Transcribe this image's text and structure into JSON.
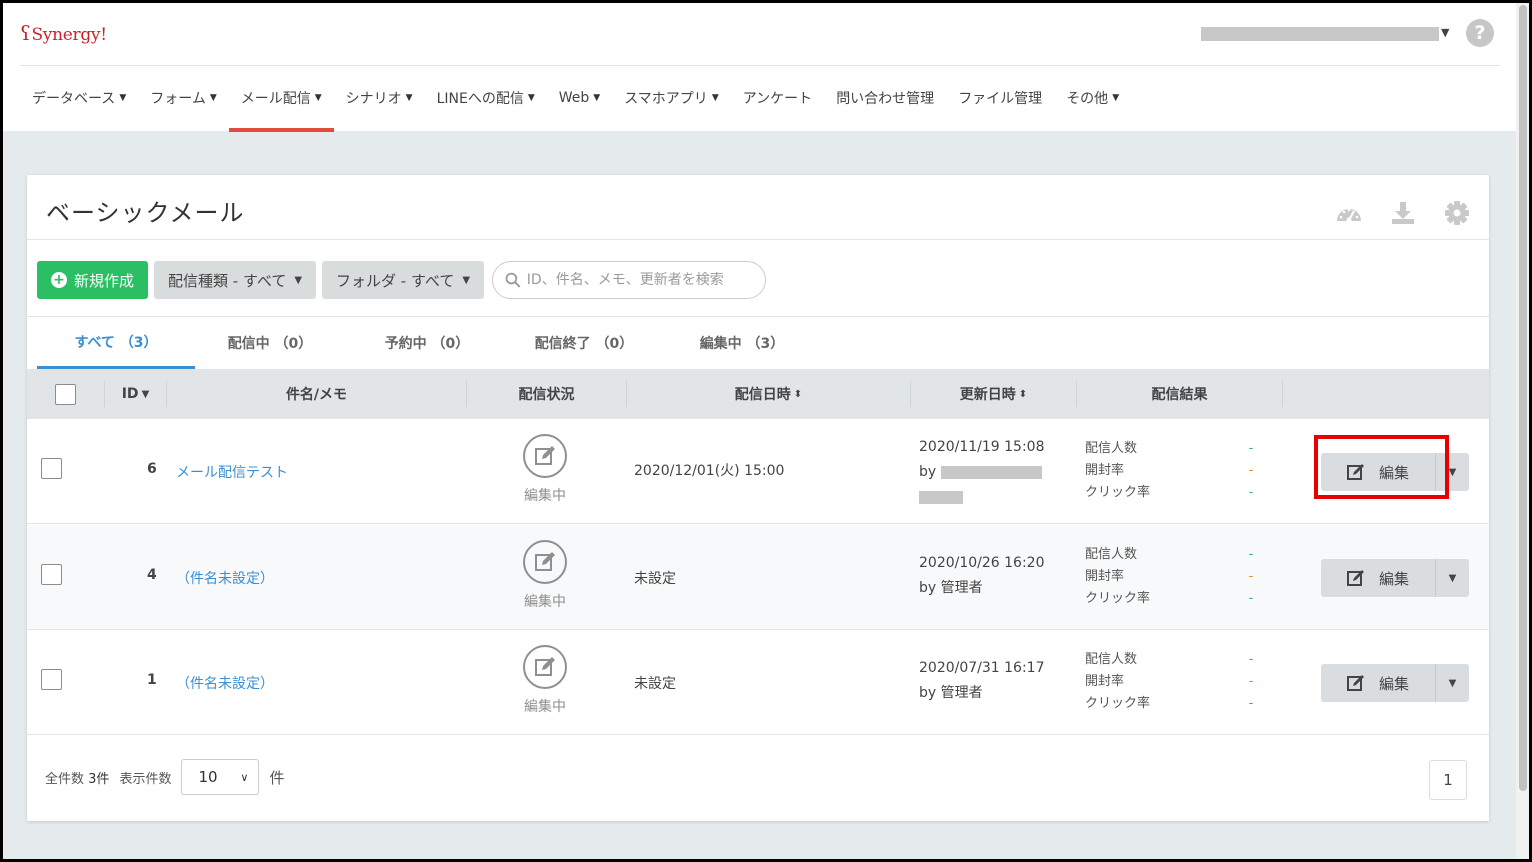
{
  "app": {
    "logo": "Synergy!",
    "help_label": "?"
  },
  "nav": [
    {
      "label": "データベース",
      "dropdown": true
    },
    {
      "label": "フォーム",
      "dropdown": true
    },
    {
      "label": "メール配信",
      "dropdown": true,
      "active": true
    },
    {
      "label": "シナリオ",
      "dropdown": true
    },
    {
      "label": "LINEへの配信",
      "dropdown": true
    },
    {
      "label": "Web",
      "dropdown": true
    },
    {
      "label": "スマホアプリ",
      "dropdown": true
    },
    {
      "label": "アンケート",
      "dropdown": false
    },
    {
      "label": "問い合わせ管理",
      "dropdown": false
    },
    {
      "label": "ファイル管理",
      "dropdown": false
    },
    {
      "label": "その他",
      "dropdown": true
    }
  ],
  "page": {
    "title": "ベーシックメール",
    "tools": [
      "dashboard-icon",
      "download-icon",
      "gear-icon"
    ]
  },
  "toolbar": {
    "new_label": "新規作成",
    "type_filter": "配信種類 - すべて",
    "folder_filter": "フォルダ - すべて",
    "search_placeholder": "ID、件名、メモ、更新者を検索"
  },
  "tabs": [
    {
      "label": "すべて （3）",
      "active": true
    },
    {
      "label": "配信中 （0）",
      "active": false
    },
    {
      "label": "予約中 （0）",
      "active": false
    },
    {
      "label": "配信終了 （0）",
      "active": false
    },
    {
      "label": "編集中 （3）",
      "active": false
    }
  ],
  "table": {
    "headers": {
      "id": "ID",
      "subject": "件名/メモ",
      "status": "配信状況",
      "send_date": "配信日時",
      "updated": "更新日時",
      "results": "配信結果"
    },
    "result_labels": [
      "配信人数",
      "開封率",
      "クリック率"
    ],
    "edit_label": "編集",
    "rows": [
      {
        "id": "6",
        "subject": "メール配信テスト",
        "status": "編集中",
        "send_date": "2020/12/01(火) 15:00",
        "updated": "2020/11/19 15:08",
        "by_prefix": "by",
        "by": "",
        "redacted": true,
        "results": [
          "-",
          "-",
          "-"
        ]
      },
      {
        "id": "4",
        "subject": "（件名未設定）",
        "status": "編集中",
        "send_date": "未設定",
        "updated": "2020/10/26 16:20",
        "by_prefix": "by",
        "by": "管理者",
        "redacted": false,
        "results": [
          "-",
          "-",
          "-"
        ]
      },
      {
        "id": "1",
        "subject": "（件名未設定）",
        "status": "編集中",
        "send_date": "未設定",
        "updated": "2020/07/31 16:17",
        "by_prefix": "by",
        "by": "管理者",
        "redacted": false,
        "results": [
          "-",
          "-",
          "-"
        ]
      }
    ]
  },
  "footer": {
    "total_label": "全件数",
    "total_value": "3件",
    "per_page_label": "表示件数",
    "per_page_value": "10",
    "per_page_unit": "件",
    "page": "1"
  },
  "colors": {
    "accent_red": "#e24a3b",
    "primary_blue": "#3a8fd2",
    "success_green": "#2bbf64",
    "highlight_red": "#e60000"
  }
}
